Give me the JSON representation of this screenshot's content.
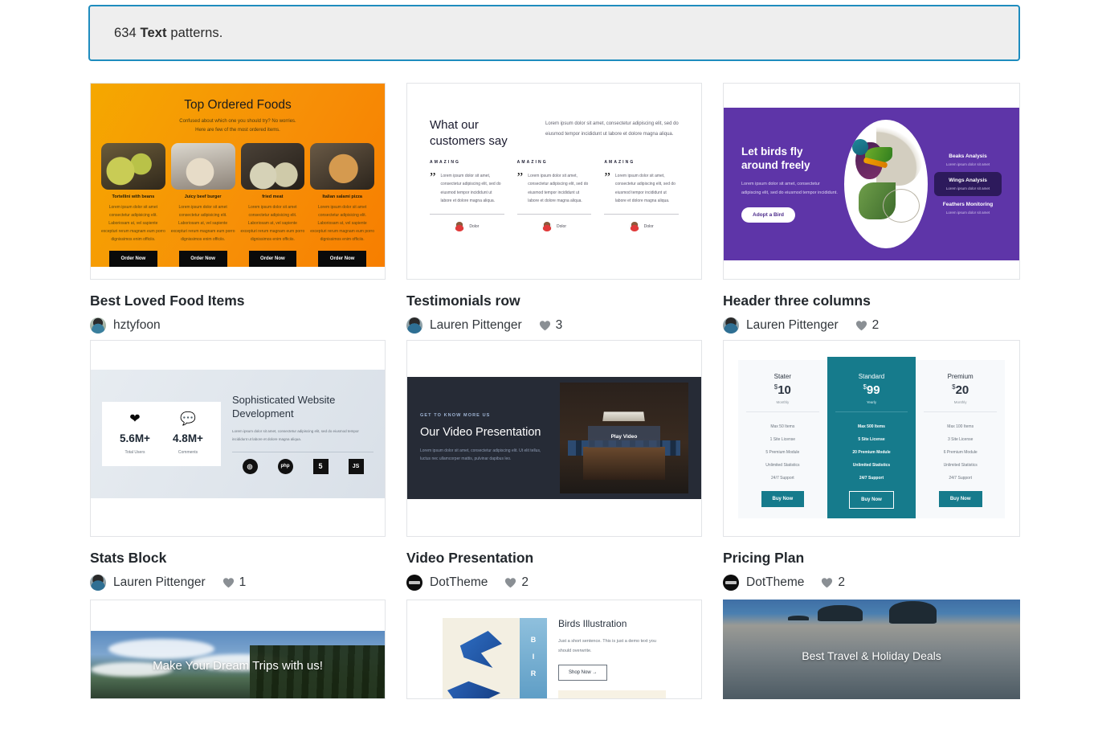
{
  "notice": {
    "count": "634",
    "bold_word": "Text",
    "suffix": "patterns."
  },
  "patterns": [
    {
      "title": "Best Loved Food Items",
      "author": "hztyfoon",
      "likes": "",
      "preview": {
        "heading": "Top Ordered Foods",
        "sub_line1": "Confused about which one you should try? No worries.",
        "sub_line2": "Here are few of the most ordered items.",
        "items": [
          {
            "name": "Tortellini with beans",
            "desc": "Lorem ipsum dolor sit amet consectetur adipisicing elit. Laboriosam at, vel sapiente excepturi rerum magnam eum porro dignissimos enim officiis.",
            "button": "Order Now"
          },
          {
            "name": "Juicy beef burger",
            "desc": "Lorem ipsum dolor sit amet consectetur adipisicing elit. Laboriosam at, vel sapiente excepturi rerum magnam eum porro dignissimos enim officiis.",
            "button": "Order Now"
          },
          {
            "name": "fried meat",
            "desc": "Lorem ipsum dolor sit amet consectetur adipisicing elit. Laboriosam at, vel sapiente excepturi rerum magnam eum porro dignissimos enim officiis.",
            "button": "Order Now"
          },
          {
            "name": "Italian salami pizza",
            "desc": "Lorem ipsum dolor sit amet consectetur adipisicing elit. Laboriosam at, vel sapiente excepturi rerum magnam eum porro dignissimos enim officiis.",
            "button": "Order Now"
          }
        ]
      }
    },
    {
      "title": "Testimonials row",
      "author": "Lauren Pittenger",
      "likes": "3",
      "preview": {
        "heading": "What our customers say",
        "lead": "Lorem ipsum dolor sit amet, consectetur adipiscing elit, sed do eiusmod tempor incididunt ut labore et dolore magna aliqua.",
        "columns": [
          {
            "kicker": "AMAZING",
            "quote": "Lorem ipsum dolor sit amet, consectetur adipiscing elit, sed do eiusmod tempor incididunt ut labore et dolore magna aliqua.",
            "person": "Dolor"
          },
          {
            "kicker": "AMAZING",
            "quote": "Lorem ipsum dolor sit amet, consectetur adipiscing elit, sed do eiusmod tempor incididunt ut labore et dolore magna aliqua.",
            "person": "Dolor"
          },
          {
            "kicker": "AMAZING",
            "quote": "Lorem ipsum dolor sit amet, consectetur adipiscing elit, sed do eiusmod tempor incididunt ut labore et dolore magna aliqua.",
            "person": "Dolor"
          }
        ]
      }
    },
    {
      "title": "Header three columns",
      "author": "Lauren Pittenger",
      "likes": "2",
      "preview": {
        "heading": "Let birds fly around freely",
        "desc": "Lorem ipsum dolor sit amet, consectetur adipiscing elit, sed do eiusmod tempor incididunt.",
        "button": "Adopt a Bird",
        "features": [
          {
            "title": "Beaks Analysis",
            "desc": "Lorem ipsum dolor sit amet",
            "active": false
          },
          {
            "title": "Wings Analysis",
            "desc": "Lorem ipsum dolor sit amet",
            "active": true
          },
          {
            "title": "Feathers Monitoring",
            "desc": "Lorem ipsum dolor sit amet",
            "active": false
          }
        ]
      }
    },
    {
      "title": "Stats Block",
      "author": "Lauren Pittenger",
      "likes": "1",
      "preview": {
        "stats": [
          {
            "icon": "heart-icon",
            "value": "5.6M+",
            "label": "Total Users"
          },
          {
            "icon": "comment-icon",
            "value": "4.8M+",
            "label": "Comments"
          }
        ],
        "heading": "Sophisticated Website Development",
        "paragraph": "Lorem ipsum dolor sit amet, consectetur adipiscing elit, sed do eiusmod tempor incididunt ut labore et dolore magna aliqua.",
        "logos": [
          "js-fiddle-logo",
          "php-logo",
          "html5-logo",
          "js-logo"
        ]
      }
    },
    {
      "title": "Video Presentation",
      "author": "DotTheme",
      "likes": "2",
      "preview": {
        "kicker": "GET TO KNOW MORE US",
        "heading": "Our Video Presentation",
        "paragraph": "Lorem ipsum dolor sit amet, consectetur adipiscing elit. Ut elit tellus, luctus nec ullamcorper mattis, pulvinar dapibus leo.",
        "play_label": "Play Video"
      }
    },
    {
      "title": "Pricing Plan",
      "author": "DotTheme",
      "likes": "2",
      "preview": {
        "plans": [
          {
            "name": "Stater",
            "currency": "$",
            "price": "10",
            "period": "Monthly",
            "features": [
              "Max 50 Items",
              "1 Site License",
              "5 Premium Module",
              "Unlimited Statistics",
              "24/7 Support"
            ],
            "button": "Buy Now",
            "featured": false
          },
          {
            "name": "Standard",
            "currency": "$",
            "price": "99",
            "period": "Yearly",
            "features": [
              "Max 500 Items",
              "5 Site License",
              "20 Premium Module",
              "Unlimited Statistics",
              "24/7 Support"
            ],
            "button": "Buy Now",
            "featured": true
          },
          {
            "name": "Premium",
            "currency": "$",
            "price": "20",
            "period": "Monthly",
            "features": [
              "Max 100 Items",
              "3 Site License",
              "6 Premium Module",
              "Unlimited Statistics",
              "24/7 Support"
            ],
            "button": "Buy Now",
            "featured": false
          }
        ]
      }
    },
    {
      "title": "",
      "author": "",
      "likes": "",
      "preview": {
        "caption": "Make Your Dream Trips with us!"
      }
    },
    {
      "title": "",
      "author": "",
      "likes": "",
      "preview": {
        "heading": "Birds Illustration",
        "paragraph": "Just a short sentence. This is just a demo text you should overwrite.",
        "button": "Shop Now →",
        "strip_letters": [
          "B",
          "I",
          "R"
        ]
      }
    },
    {
      "title": "",
      "author": "",
      "likes": "",
      "preview": {
        "caption": "Best Travel & Holiday Deals"
      }
    }
  ],
  "colors": {
    "notice_border": "#1e8cbe",
    "notice_bg": "#eeeeee",
    "foods_accent": "#f5a800",
    "bird_purple": "#5e35a8",
    "bird_purple_dark": "#2d1a5c",
    "video_dark": "#262b36",
    "pricing_teal": "#167b8c",
    "heart_gray": "#8a8f94"
  }
}
